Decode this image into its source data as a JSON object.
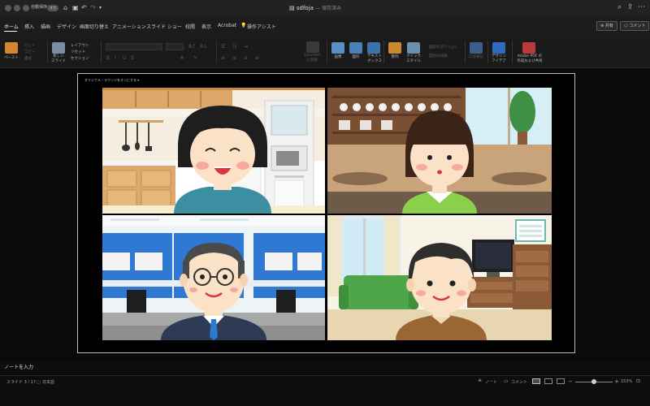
{
  "titlebar": {
    "autosave_label": "自動保存",
    "autosave_state": "オフ",
    "doc_title": "sdfoja",
    "doc_subtitle": "— 保存済み",
    "search_icon": "search-icon",
    "share_icon": "share-icon",
    "more_icon": "more-icon"
  },
  "tabs": [
    {
      "label": "ホーム",
      "active": true
    },
    {
      "label": "挿入"
    },
    {
      "label": "描画"
    },
    {
      "label": "デザイン"
    },
    {
      "label": "画面切り替え"
    },
    {
      "label": "アニメーション"
    },
    {
      "label": "スライド ショー"
    },
    {
      "label": "校閲"
    },
    {
      "label": "表示"
    },
    {
      "label": "Acrobat"
    },
    {
      "label": "操作アシスト"
    }
  ],
  "ribbon_actions": {
    "share_label": "共有",
    "comment_label": "コメント"
  },
  "ribbon": {
    "paste": "ペースト",
    "cut": "カット",
    "copy": "コピー",
    "format": "書式",
    "new_slide_1": "新しい",
    "new_slide_2": "スライド",
    "layout": "レイアウト",
    "reset": "リセット",
    "section": "セクション",
    "smartart_1": "SmartArt",
    "smartart_2": "に変換",
    "picture": "画像",
    "shape": "図形",
    "textbox_1": "テキスト",
    "textbox_2": "ボックス",
    "arrange": "整列",
    "quick_styles_1": "クイック",
    "quick_styles_2": "スタイル",
    "shape_fill": "図形の塗りつぶし",
    "shape_outline": "図形の枠線",
    "dictate": "口述筆記",
    "designer_1": "デザイン",
    "designer_2": "アイデア",
    "acrobat_1": "Adobe PDF の",
    "acrobat_2": "作成および共有"
  },
  "slide": {
    "caption": "オリジナル・ラウンジをオンにする ▾",
    "tiles": [
      {
        "name": "video-tile-woman-kitchen"
      },
      {
        "name": "video-tile-girl-cafe"
      },
      {
        "name": "video-tile-man-office"
      },
      {
        "name": "video-tile-man-livingroom"
      }
    ]
  },
  "notes_placeholder": "ノートを入力",
  "status": {
    "slide_counter": "スライド 3 / 17",
    "language": "日本語",
    "notes_label": "ノート",
    "comments_label": "コメント",
    "zoom": "153%"
  },
  "colors": {
    "accent_orange": "#e3862f",
    "ribbon_bg": "#1a1a1a"
  }
}
